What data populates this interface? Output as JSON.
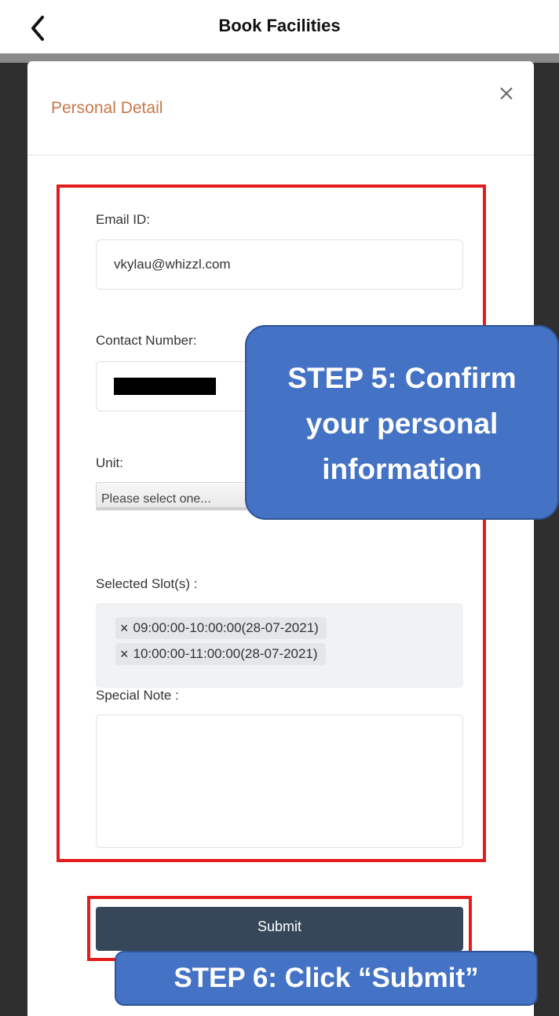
{
  "header": {
    "title": "Book Facilities",
    "back_icon": "chevron-left-icon"
  },
  "modal": {
    "title": "Personal Detail",
    "close_icon": "close-icon",
    "email": {
      "label": "Email ID:",
      "value": "vkylau@whizzl.com"
    },
    "contact": {
      "label": "Contact Number:",
      "value_redacted": true
    },
    "unit": {
      "label": "Unit:",
      "placeholder": "Please select one..."
    },
    "slots": {
      "label": "Selected Slot(s) :",
      "items": [
        {
          "remove": "×",
          "text": "09:00:00-10:00:00(28-07-2021)"
        },
        {
          "remove": "×",
          "text": "10:00:00-11:00:00(28-07-2021)"
        }
      ]
    },
    "note": {
      "label": "Special Note :",
      "value": ""
    },
    "submit_label": "Submit"
  },
  "annotations": {
    "step5": {
      "line1": "STEP 5: Confirm",
      "line2": "your personal",
      "line3": "information"
    },
    "step6": "STEP 6: Click “Submit”"
  },
  "colors": {
    "title_accent": "#c9784b",
    "submit_bg": "#36475a",
    "callout_bg": "#4472c4",
    "highlight_border": "#e51c1c"
  }
}
